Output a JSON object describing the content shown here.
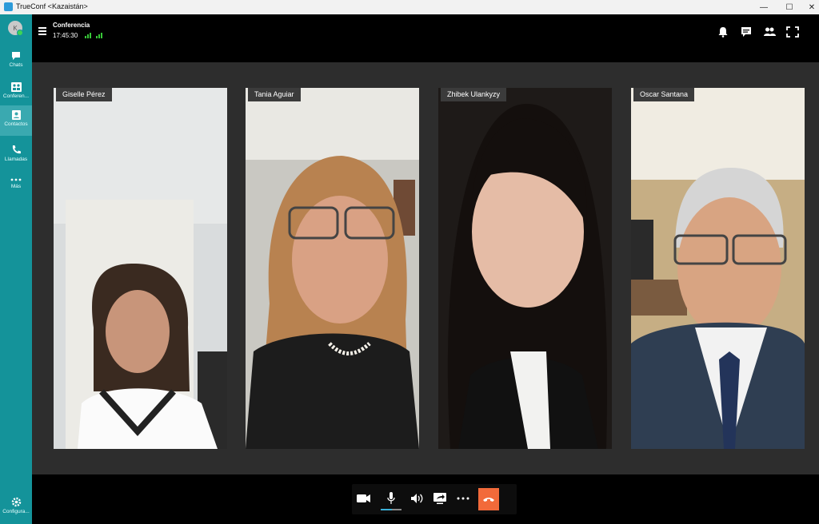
{
  "window": {
    "title": "TrueConf <Kazaistán>",
    "minimize": "—",
    "maximize": "☐",
    "close": "✕"
  },
  "sidebar": {
    "avatar_initial": "K",
    "items": [
      {
        "label": "Chats",
        "icon": "chat-icon"
      },
      {
        "label": "Conferen...",
        "icon": "conference-icon"
      },
      {
        "label": "Contactos",
        "icon": "contacts-icon"
      },
      {
        "label": "Llamadas",
        "icon": "phone-icon"
      },
      {
        "label": "Más",
        "icon": "more-icon"
      }
    ],
    "settings": {
      "label": "Configura...",
      "icon": "gear-icon"
    }
  },
  "header": {
    "title": "Conferencia",
    "time": "17:45:30",
    "icons": [
      "bell-icon",
      "chat-icon",
      "participants-icon",
      "fullscreen-icon"
    ]
  },
  "participants": [
    {
      "name": "Giselle Pérez"
    },
    {
      "name": "Tania Aguiar"
    },
    {
      "name": "Zhibek Ulankyzy"
    },
    {
      "name": "Oscar Santana"
    }
  ],
  "controls": {
    "icons": [
      "camera-icon",
      "microphone-icon",
      "speaker-icon",
      "share-screen-icon",
      "more-icon",
      "hangup-icon"
    ],
    "mic_level": 0.55
  },
  "colors": {
    "sidebar": "#14939a",
    "sidebar_active": "#3aa9b0",
    "hangup": "#f26a3a",
    "signal": "#37c837"
  }
}
